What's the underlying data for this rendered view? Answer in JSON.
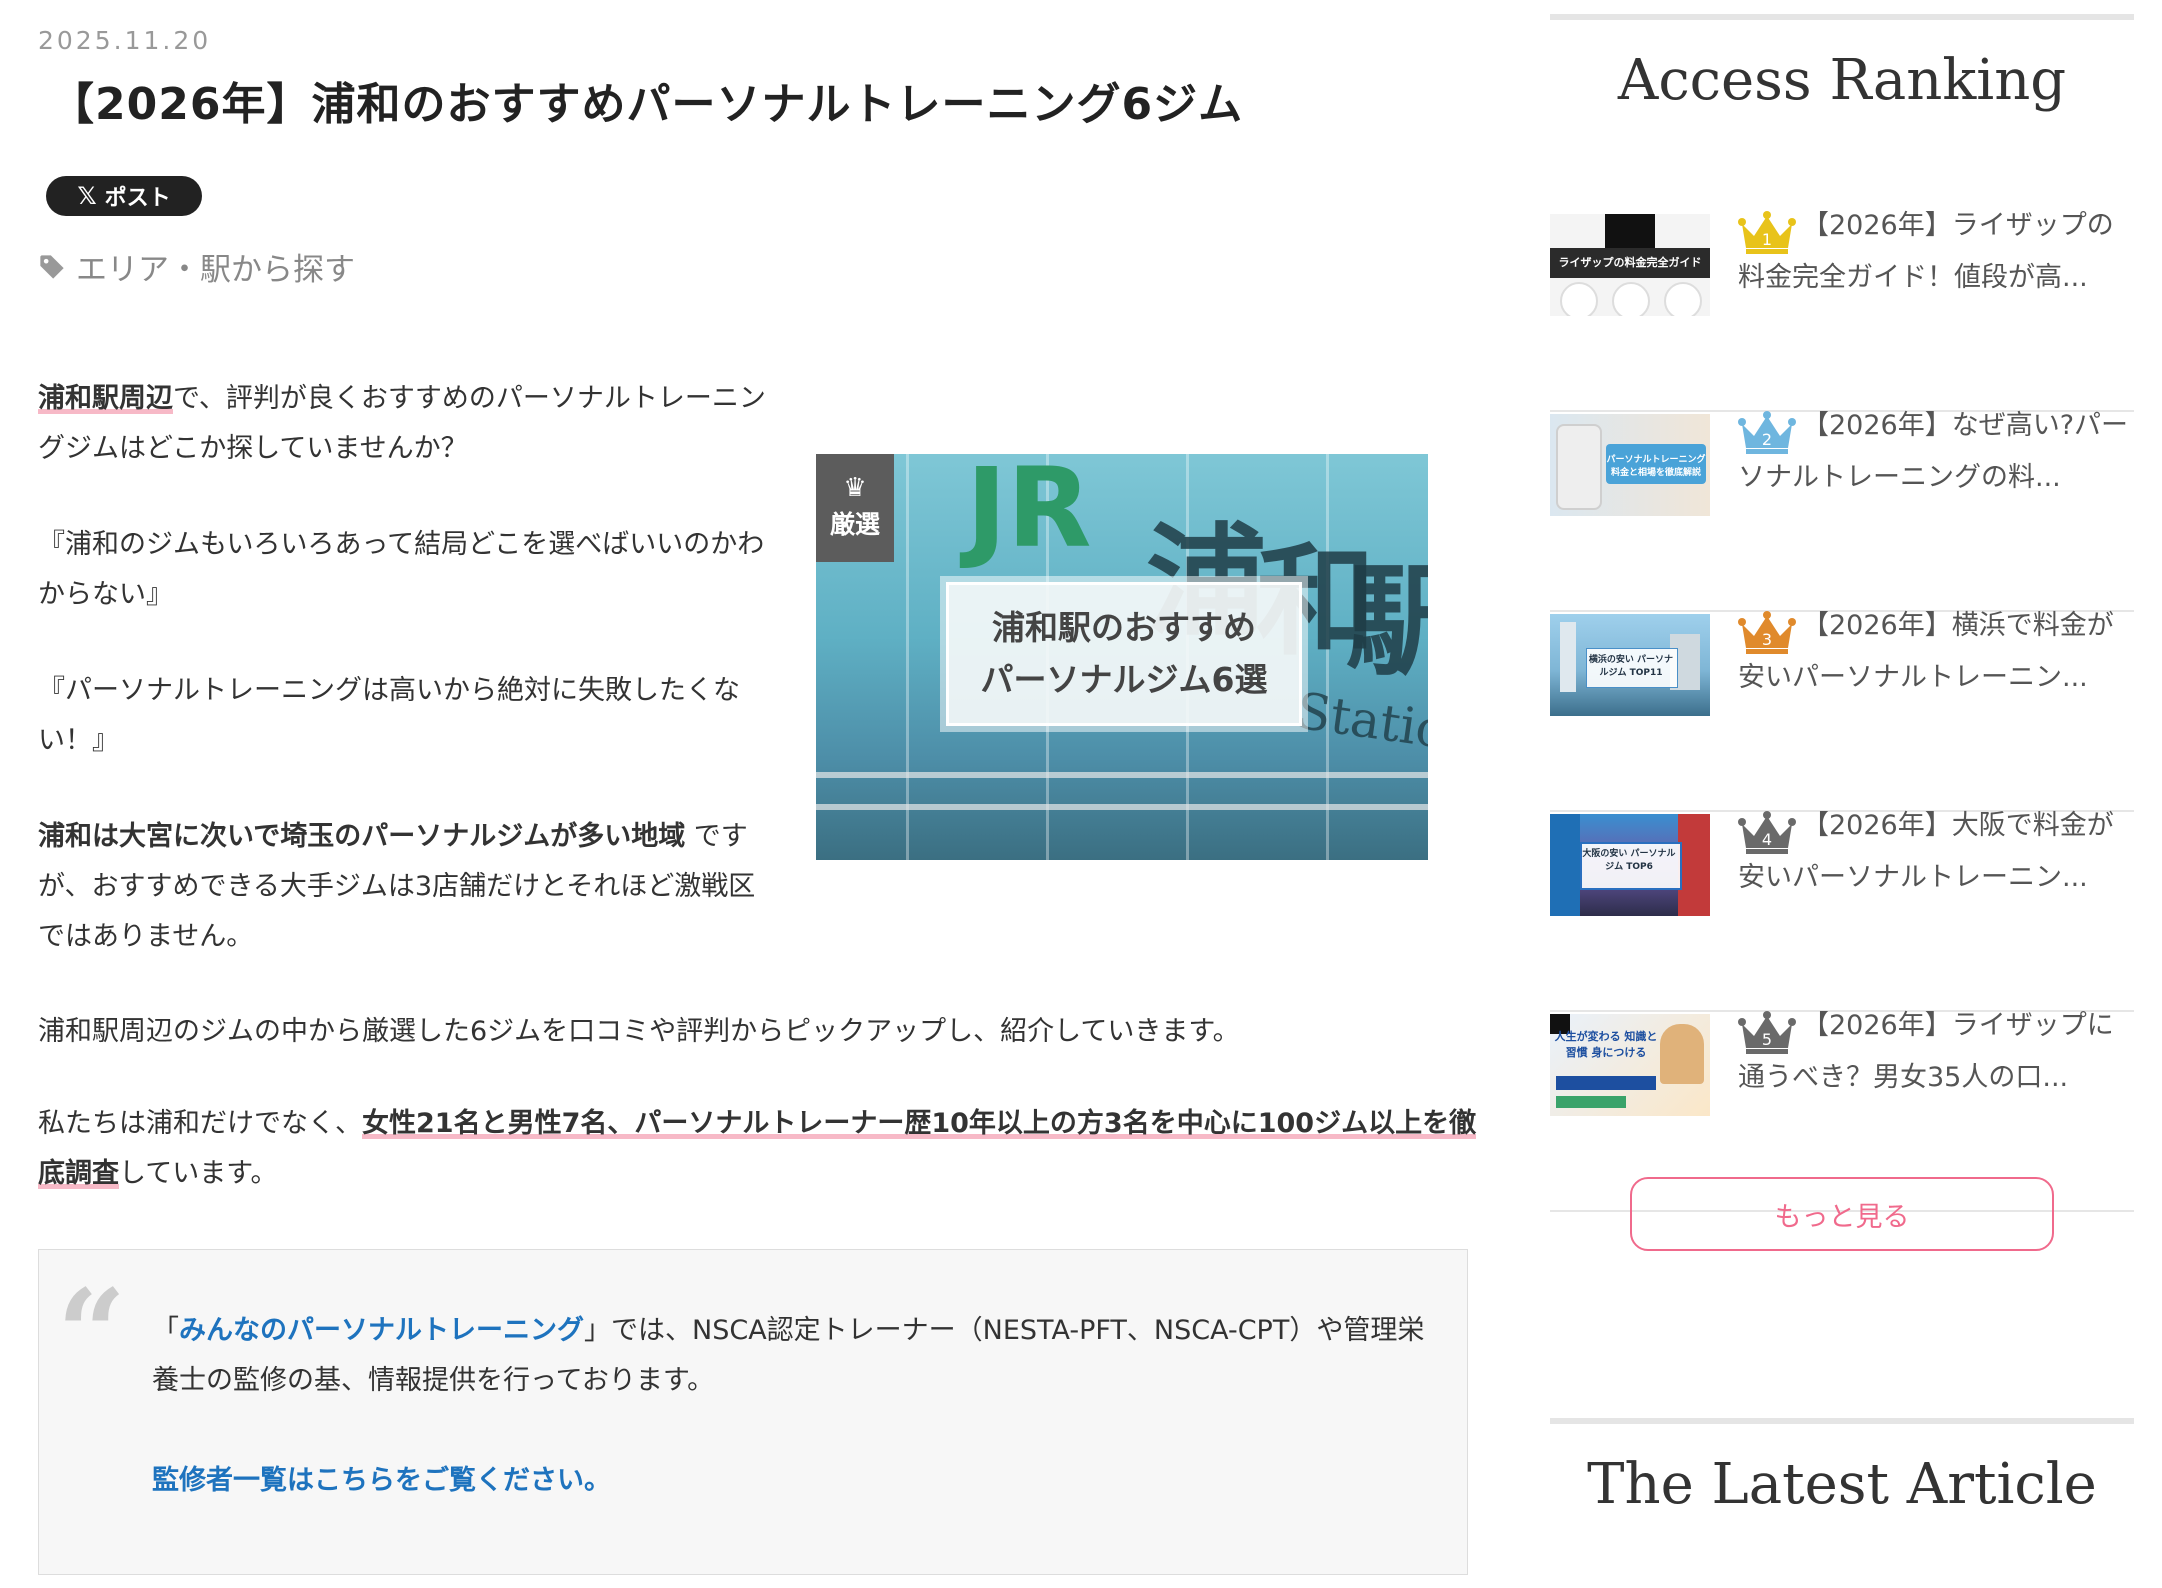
{
  "article": {
    "date": "2025.11.20",
    "title": "【2026年】浦和のおすすめパーソナルトレーニング6ジム",
    "share_label": "ポスト",
    "share_logo": "𝕏",
    "tag_icon": "tag-icon",
    "tag_label": "エリア・駅から探す",
    "p1_emph": "浦和駅周辺",
    "p1_rest": "で、評判が良くおすすめのパーソナルトレーニングジムはどこか探していませんか？",
    "p2": "『浦和のジムもいろいろあって結局どこを選べばいいのかわからない』",
    "p3": "『パーソナルトレーニングは高いから絶対に失敗したくない！』",
    "p4_bold": "浦和は大宮に次いで埼玉のパーソナルジムが多い地域",
    "p4_rest": "ですが、おすすめできる大手ジムは3店舗だけとそれほど激戦区ではありません。",
    "p5": "浦和駅周辺のジムの中から厳選した6ジムを口コミや評判からピックアップし、紹介していきます。",
    "p6_pre": "私たちは浦和だけでなく、",
    "p6_emph": "女性21名と男性7名、パーソナルトレーナー歴10年以上の方3名を中心に100ジム以上を徹底調査",
    "p6_post": "しています。",
    "hero": {
      "badge": "厳選",
      "plate_line1": "浦和駅のおすすめ",
      "plate_line2": "パーソナルジム6選",
      "sign_jr": "JR",
      "sign_chars": [
        "浦",
        "和",
        "駅"
      ],
      "sign_station": "Station"
    },
    "quote": {
      "open": "「",
      "link": "みんなのパーソナルトレーニング",
      "rest": "」では、NSCA認定トレーナー（NESTA-PFT、NSCA-CPT）や管理栄養士の監修の基、情報提供を行っております。",
      "supervisor_link": "監修者一覧はこちらをご覧ください。"
    }
  },
  "sidebar": {
    "ranking_heading": "Access Ranking",
    "items": [
      {
        "rank": "1",
        "title": "【2026年】ライザップの料金完全ガイド！値段が高...",
        "thumb_text": "ライザップの料金完全ガイド"
      },
      {
        "rank": "2",
        "title": "【2026年】なぜ高い?パーソナルトレーニングの料...",
        "thumb_text": "パーソナルトレーニング 料金と相場を徹底解説"
      },
      {
        "rank": "3",
        "title": "【2026年】横浜で料金が安いパーソナルトレーニン...",
        "thumb_text": "横浜の安い パーソナルジム TOP11"
      },
      {
        "rank": "4",
        "title": "【2026年】大阪で料金が安いパーソナルトレーニン...",
        "thumb_text": "大阪の安い パーソナルジム TOP6"
      },
      {
        "rank": "5",
        "title": "【2026年】ライザップに通うべき？男女35人の口...",
        "thumb_text": "人生が変わる 知識と習慣 身につける"
      }
    ],
    "more_label": "もっと見る",
    "latest_heading": "The Latest Article"
  },
  "colors": {
    "accent_pink": "#f06a8c",
    "link_blue": "#1e73be",
    "gold": "#e8c31a",
    "blue": "#6fb6df",
    "bronze": "#e08a2c",
    "gray": "#6a6a6a"
  }
}
